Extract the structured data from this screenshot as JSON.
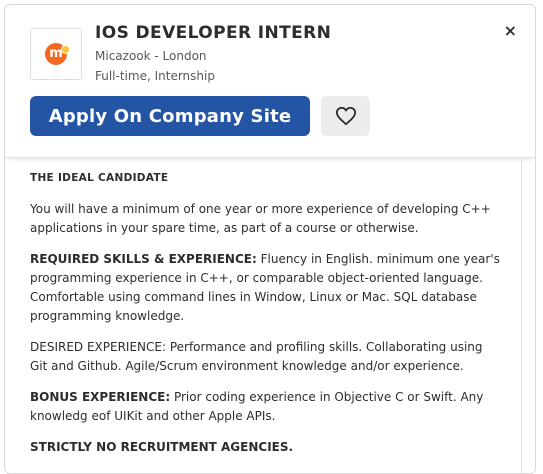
{
  "header": {
    "logo_letter": "m",
    "title": "IOS DEVELOPER INTERN",
    "company_location": "Micazook - London",
    "job_type": "Full-time, Internship",
    "close_symbol": "×",
    "apply_label": "Apply On Company Site",
    "save_icon": "heart-icon"
  },
  "description": {
    "heading": "THE IDEAL CANDIDATE",
    "intro": "You will have a minimum of one year or more experience of developing C++ applications in your spare time, as part of a course or otherwise.",
    "required_label": "REQUIRED SKILLS & EXPERIENCE:",
    "required_text": " Fluency in English. minimum one year's programming experience in C++, or comparable object-oriented language. Comfortable using command lines in Window, Linux or Mac. SQL database programming knowledge.",
    "desired_text": "DESIRED EXPERIENCE: Performance and profiling skills. Collaborating using Git and Github. Agile/Scrum environment knowledge and/or experience.",
    "bonus_label": "BONUS EXPERIENCE:",
    "bonus_text": " Prior coding experience in Objective C or Swift. Any knowledg eof UIKit and other Apple APIs.",
    "strict_note": "STRICTLY NO RECRUITMENT AGENCIES."
  },
  "colors": {
    "apply_button": "#2455a4",
    "save_button": "#ececec",
    "logo": "#f26a21"
  }
}
